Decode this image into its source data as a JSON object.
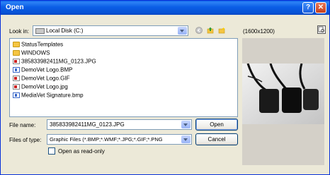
{
  "dialog": {
    "title": "Open"
  },
  "lookin": {
    "label": "Look in:",
    "value": "Local Disk (C:)"
  },
  "preview_size": "(1600x1200)",
  "files": [
    {
      "name": "StatusTemplates",
      "type": "folder"
    },
    {
      "name": "WINDOWS",
      "type": "folder"
    },
    {
      "name": "385833982411MG_0123.JPG",
      "type": "jpg"
    },
    {
      "name": "DemoVet Logo.BMP",
      "type": "bmp"
    },
    {
      "name": "DemoVet Logo.GIF",
      "type": "jpg"
    },
    {
      "name": "DemoVet Logo.jpg",
      "type": "jpg"
    },
    {
      "name": "MediaVet Signature.bmp",
      "type": "bmp"
    }
  ],
  "filename": {
    "label": "File name:",
    "value": "385833982411MG_0123.JPG"
  },
  "filetype": {
    "label": "Files of type:",
    "value": "Graphic Files (*.BMP;*.WMF;*.JPG;*.GIF;*.PNG"
  },
  "readonly": {
    "label": "Open as read-only",
    "checked": false
  },
  "buttons": {
    "open": "Open",
    "cancel": "Cancel"
  }
}
